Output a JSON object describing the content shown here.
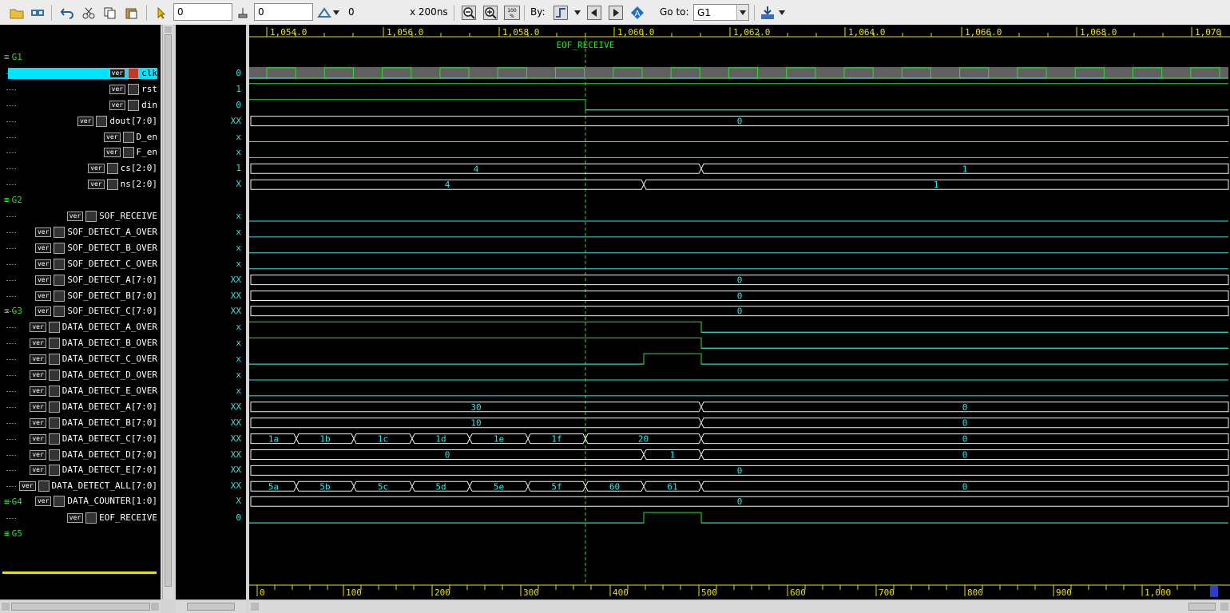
{
  "toolbar": {
    "cursor_time": "0",
    "marker_time": "0",
    "delta_value": "0",
    "zoom_unit": "x 200ns",
    "by_label": "By:",
    "goto_label": "Go to:",
    "goto_value": "G1",
    "zoom_fit_label": "100 %",
    "search_badge": "A"
  },
  "groups": [
    {
      "label": "G1",
      "row": 1
    },
    {
      "label": "G2",
      "row": 10
    },
    {
      "label": "G3",
      "row": 17
    },
    {
      "label": "G4",
      "row": 29
    },
    {
      "label": "G5",
      "row": 31
    }
  ],
  "signals": [
    {
      "name": "clk",
      "value": "0",
      "row": 2,
      "icon": "clock",
      "selected": true
    },
    {
      "name": "rst",
      "value": "1",
      "row": 3,
      "icon": "wire"
    },
    {
      "name": "din",
      "value": "0",
      "row": 4,
      "icon": "wire"
    },
    {
      "name": "dout[7:0]",
      "value": "XX",
      "row": 5,
      "icon": "bus"
    },
    {
      "name": "D_en",
      "value": "x",
      "row": 6,
      "icon": "bus"
    },
    {
      "name": "F_en",
      "value": "x",
      "row": 7,
      "icon": "bus"
    },
    {
      "name": "cs[2:0]",
      "value": "1",
      "row": 8,
      "icon": "wire"
    },
    {
      "name": "ns[2:0]",
      "value": "X",
      "row": 9,
      "icon": "wire"
    },
    {
      "name": "SOF_RECEIVE",
      "value": "x",
      "row": 11,
      "icon": "wire"
    },
    {
      "name": "SOF_DETECT_A_OVER",
      "value": "x",
      "row": 12,
      "icon": "wire"
    },
    {
      "name": "SOF_DETECT_B_OVER",
      "value": "x",
      "row": 13,
      "icon": "wire"
    },
    {
      "name": "SOF_DETECT_C_OVER",
      "value": "x",
      "row": 14,
      "icon": "wire"
    },
    {
      "name": "SOF_DETECT_A[7:0]",
      "value": "XX",
      "row": 15,
      "icon": "wire"
    },
    {
      "name": "SOF_DETECT_B[7:0]",
      "value": "XX",
      "row": 16,
      "icon": "wire"
    },
    {
      "name": "SOF_DETECT_C[7:0]",
      "value": "XX",
      "row": 17.0,
      "icon": "wire"
    },
    {
      "name": "DATA_DETECT_A_OVER",
      "value": "x",
      "row": 18,
      "icon": "wire"
    },
    {
      "name": "DATA_DETECT_B_OVER",
      "value": "x",
      "row": 19,
      "icon": "wire"
    },
    {
      "name": "DATA_DETECT_C_OVER",
      "value": "x",
      "row": 20,
      "icon": "wire"
    },
    {
      "name": "DATA_DETECT_D_OVER",
      "value": "x",
      "row": 21,
      "icon": "wire"
    },
    {
      "name": "DATA_DETECT_E_OVER",
      "value": "x",
      "row": 22,
      "icon": "wire"
    },
    {
      "name": "DATA_DETECT_A[7:0]",
      "value": "XX",
      "row": 23,
      "icon": "wire"
    },
    {
      "name": "DATA_DETECT_B[7:0]",
      "value": "XX",
      "row": 24,
      "icon": "wire"
    },
    {
      "name": "DATA_DETECT_C[7:0]",
      "value": "XX",
      "row": 25,
      "icon": "wire"
    },
    {
      "name": "DATA_DETECT_D[7:0]",
      "value": "XX",
      "row": 26,
      "icon": "wire"
    },
    {
      "name": "DATA_DETECT_E[7:0]",
      "value": "XX",
      "row": 27,
      "icon": "wire"
    },
    {
      "name": "DATA_DETECT_ALL[7:0]",
      "value": "XX",
      "row": 28,
      "icon": "bus"
    },
    {
      "name": "DATA_COUNTER[1:0]",
      "value": "X",
      "row": 29.0,
      "icon": "wire"
    },
    {
      "name": "EOF_RECEIVE",
      "value": "0",
      "row": 30,
      "icon": "wire"
    }
  ],
  "ruler_top": [
    "1,054.0",
    "1,056.0",
    "1,058.0",
    "1,060.0",
    "1,062.0",
    "1,064.0",
    "1,066.0",
    "1,068.0",
    "1,070"
  ],
  "ruler_bottom": [
    "0",
    "100",
    "200",
    "300",
    "400",
    "500",
    "600",
    "700",
    "800",
    "900",
    "1,000"
  ],
  "marker": {
    "label": "EOF_RECEIVE"
  },
  "bus_values": {
    "dout": [
      "0"
    ],
    "cs": [
      "4",
      "1"
    ],
    "ns": [
      "4",
      "1"
    ],
    "sof_a": [
      "0"
    ],
    "sof_b": [
      "0"
    ],
    "sof_c": [
      "0"
    ],
    "data_a": [
      "30",
      "0"
    ],
    "data_b": [
      "10",
      "0"
    ],
    "data_c": [
      "1a",
      "1b",
      "1c",
      "1d",
      "1e",
      "1f",
      "20",
      "0"
    ],
    "data_d": [
      "0",
      "1",
      "0"
    ],
    "data_e": [
      "0"
    ],
    "data_all": [
      "5a",
      "5b",
      "5c",
      "5d",
      "5e",
      "5f",
      "60",
      "61",
      "0"
    ],
    "counter": [
      "0"
    ]
  },
  "colors": {
    "wave_green": "#2edc2e",
    "wave_cyan": "#2ee6e6",
    "bus_white": "#f0f0f0",
    "ruler_yellow": "#e8e000",
    "selection": "#00e5ff"
  }
}
